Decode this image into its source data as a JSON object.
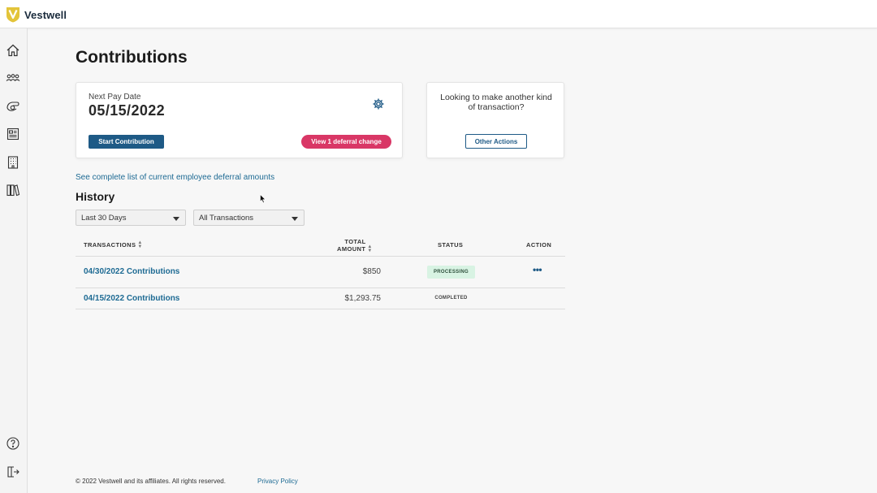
{
  "brand": {
    "name": "Vestwell"
  },
  "sidebar": {
    "items": [
      {
        "icon": "home-icon"
      },
      {
        "icon": "people-icon"
      },
      {
        "icon": "contributions-icon"
      },
      {
        "icon": "document-icon"
      },
      {
        "icon": "building-icon"
      },
      {
        "icon": "library-icon"
      }
    ],
    "bottom": [
      {
        "icon": "help-icon"
      },
      {
        "icon": "logout-icon"
      }
    ]
  },
  "page": {
    "title": "Contributions"
  },
  "pay_card": {
    "label": "Next Pay Date",
    "date": "05/15/2022",
    "start_button": "Start Contribution",
    "deferral_button": "View 1 deferral change"
  },
  "other_card": {
    "question": "Looking to make another kind of transaction?",
    "button": "Other Actions"
  },
  "deferral_link": "See complete list of current employee deferral amounts",
  "history": {
    "title": "History",
    "filters": {
      "range": "Last 30 Days",
      "type": "All Transactions"
    },
    "columns": {
      "transactions": "TRANSACTIONS",
      "total_amount_1": "TOTAL",
      "total_amount_2": "AMOUNT",
      "status": "STATUS",
      "action": "ACTION"
    },
    "rows": [
      {
        "name": "04/30/2022 Contributions",
        "amount": "$850",
        "status": "PROCESSING",
        "action": "•••"
      },
      {
        "name": "04/15/2022 Contributions",
        "amount": "$1,293.75",
        "status": "COMPLETED",
        "action": ""
      }
    ]
  },
  "footer": {
    "copyright": "© 2022 Vestwell and its affiliates. All rights reserved.",
    "privacy": "Privacy Policy"
  },
  "colors": {
    "primary": "#1e5a86",
    "accent_pink": "#d93766",
    "link": "#1d6a93",
    "processing_bg": "#d8f3e3",
    "logo_yellow": "#e3c43a"
  }
}
